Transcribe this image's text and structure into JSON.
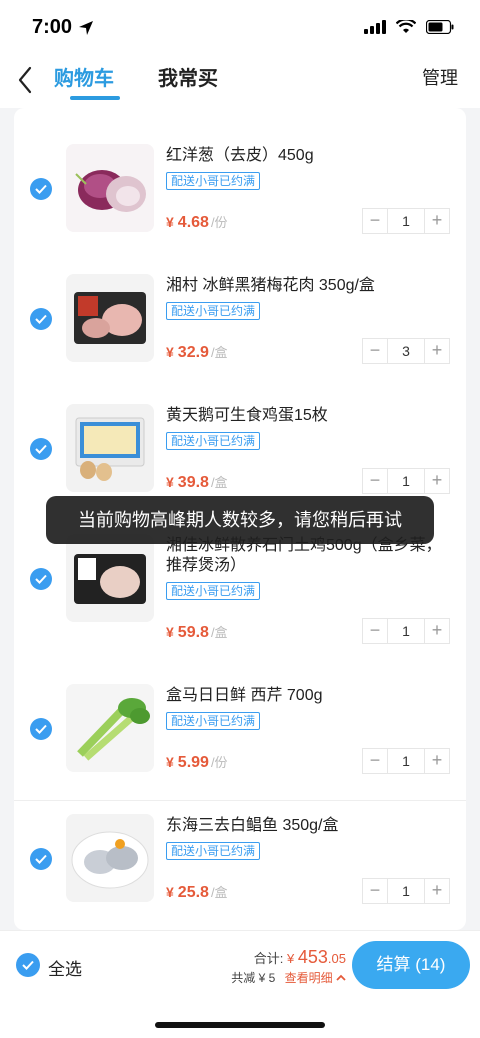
{
  "status_bar": {
    "time": "7:00"
  },
  "nav": {
    "tab_cart": "购物车",
    "tab_frequent": "我常买",
    "manage": "管理"
  },
  "items": [
    {
      "name": "红洋葱（去皮）450g",
      "tag": "配送小哥已约满",
      "price": "4.68",
      "unit": "/份",
      "qty": "1",
      "image": "red-onion"
    },
    {
      "name": "湘村 冰鲜黑猪梅花肉 350g/盒",
      "tag": "配送小哥已约满",
      "price": "32.9",
      "unit": "/盒",
      "qty": "3",
      "image": "pork-pack"
    },
    {
      "name": "黄天鹅可生食鸡蛋15枚",
      "tag": "配送小哥已约满",
      "price": "39.8",
      "unit": "/盒",
      "qty": "1",
      "image": "egg-box"
    },
    {
      "name": "湘佳冰鲜散养石门土鸡500g（盒乡菜，推荐煲汤）",
      "tag": "配送小哥已约满",
      "price": "59.8",
      "unit": "/盒",
      "qty": "1",
      "image": "chicken-pack"
    },
    {
      "name": "盒马日日鲜 西芹 700g",
      "tag": "配送小哥已约满",
      "price": "5.99",
      "unit": "/份",
      "qty": "1",
      "image": "celery"
    },
    {
      "name": "东海三去白鲳鱼 350g/盒",
      "tag": "配送小哥已约满",
      "price": "25.8",
      "unit": "/盒",
      "qty": "1",
      "image": "pomfret"
    }
  ],
  "currency": "¥",
  "toast": "当前购物高峰期人数较多，请您稍后再试",
  "bottom": {
    "select_all": "全选",
    "total_label": "合计:",
    "total_currency": "¥",
    "total_int": "453",
    "total_dec": ".05",
    "discount": "共减 ¥ 5",
    "detail": "查看明细",
    "checkout": "结算 (14)"
  },
  "colors": {
    "accent": "#3a9df0",
    "price": "#e55a3a"
  }
}
